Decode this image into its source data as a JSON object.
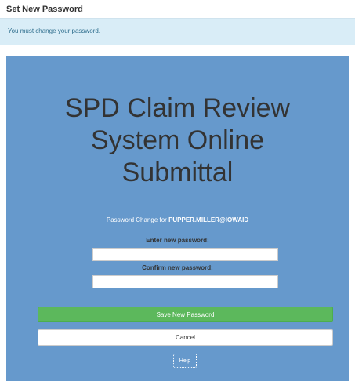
{
  "header": {
    "title": "Set New Password"
  },
  "alert": {
    "message": "You must change your password."
  },
  "panel": {
    "title_lines": [
      "SPD Claim Review",
      "System Online",
      "Submittal"
    ],
    "password_change_prefix": "Password Change for",
    "username": "PUPPER.MILLER@IOWAID"
  },
  "form": {
    "new_password_label": "Enter new password:",
    "new_password_value": "",
    "confirm_password_label": "Confirm new password:",
    "confirm_password_value": ""
  },
  "buttons": {
    "save_label": "Save New Password",
    "cancel_label": "Cancel",
    "help_label": "Help"
  },
  "colors": {
    "panel_background": "#6699cc",
    "alert_background": "#d9edf7",
    "save_button": "#5cb85c"
  }
}
